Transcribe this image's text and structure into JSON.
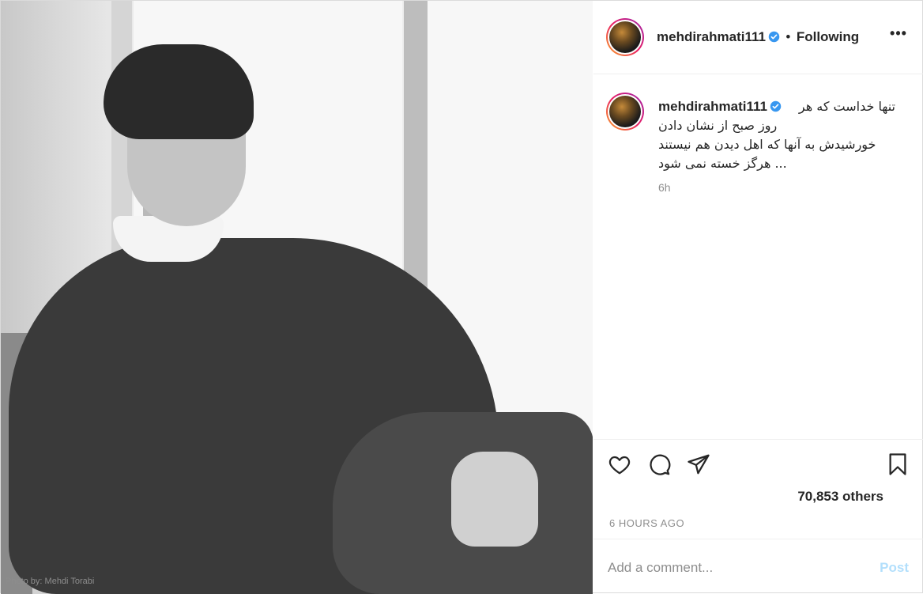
{
  "post": {
    "photo_credit": "Photo by: Mehdi Torabi",
    "photo_subject": "photo-portrait"
  },
  "header": {
    "username": "mehdirahmati111",
    "separator": "•",
    "follow_status": "Following",
    "more_label": "•••"
  },
  "caption": {
    "username": "mehdirahmati111",
    "lines": [
      "تنها خداست که هر",
      "روز صبح از نشان دادن",
      "خورشیدش به آنها که اهل دیدن هم نیستند",
      "... هرگز خسته نمی شود"
    ],
    "time": "6h"
  },
  "actions": {
    "icons": [
      "heart-icon",
      "comment-icon",
      "share-icon",
      "bookmark-icon"
    ],
    "likes_text": "70,853 others",
    "posted_ago": "6 HOURS AGO"
  },
  "comment": {
    "placeholder": "Add a comment...",
    "post_label": "Post"
  },
  "colors": {
    "verified_blue": "#3897f0",
    "post_disabled": "#b2dffc",
    "muted_text": "#8e8e8e"
  }
}
